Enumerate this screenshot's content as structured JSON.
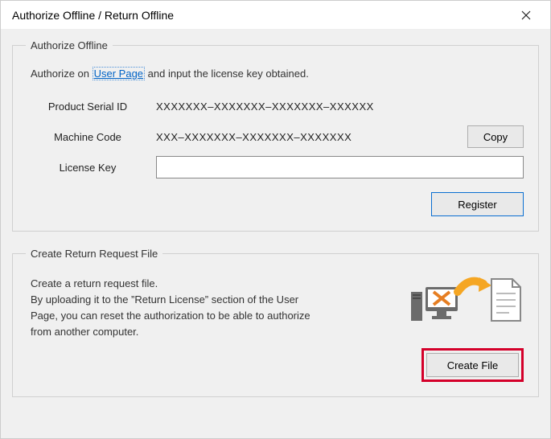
{
  "window": {
    "title": "Authorize Offline / Return Offline"
  },
  "authorize": {
    "legend": "Authorize Offline",
    "intro_prefix": "Authorize on ",
    "intro_link": "User Page",
    "intro_suffix": " and input the license key obtained.",
    "serial_label": "Product Serial ID",
    "serial_value": "XXXXXXX–XXXXXXX–XXXXXXX–XXXXXX",
    "machine_label": "Machine Code",
    "machine_value": "XXX–XXXXXXX–XXXXXXX–XXXXXXX",
    "copy_label": "Copy",
    "license_label": "License Key",
    "license_value": "",
    "register_label": "Register"
  },
  "returnreq": {
    "legend": "Create Return Request File",
    "desc": "Create a return request file.\nBy uploading it to the ”Return License” section of the User Page, you can reset the authorization to be able to authorize from another computer.",
    "createfile_label": "Create File"
  }
}
